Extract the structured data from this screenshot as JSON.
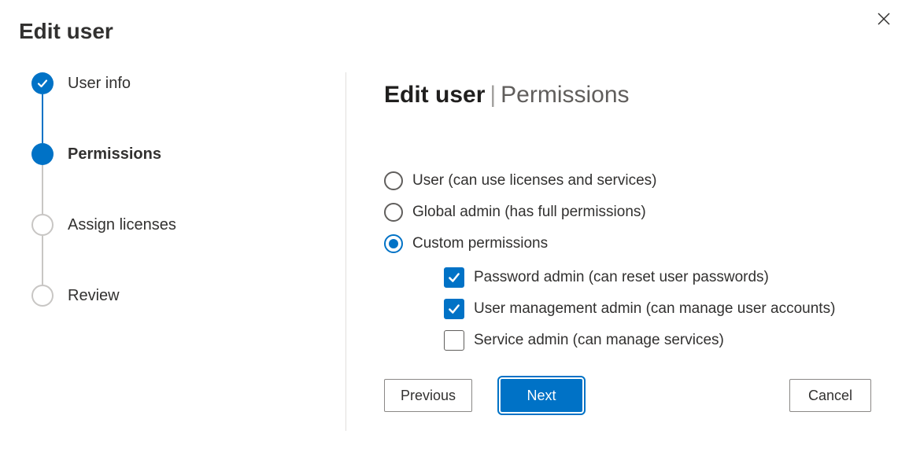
{
  "dialog_title": "Edit user",
  "close_label": "Close",
  "steps": [
    {
      "label": "User info",
      "state": "completed"
    },
    {
      "label": "Permissions",
      "state": "current"
    },
    {
      "label": "Assign licenses",
      "state": "upcoming"
    },
    {
      "label": "Review",
      "state": "upcoming"
    }
  ],
  "panel": {
    "heading_bold": "Edit user",
    "heading_rest": "Permissions"
  },
  "radios": {
    "user": {
      "label": "User (can use licenses and services)",
      "selected": false
    },
    "global": {
      "label": "Global admin (has full permissions)",
      "selected": false
    },
    "custom": {
      "label": "Custom permissions",
      "selected": true
    }
  },
  "custom_checks": {
    "password": {
      "label": "Password admin (can reset user passwords)",
      "checked": true
    },
    "usermgmt": {
      "label": "User management admin (can manage user accounts)",
      "checked": true
    },
    "service": {
      "label": "Service admin (can manage services)",
      "checked": false
    }
  },
  "buttons": {
    "previous": "Previous",
    "next": "Next",
    "cancel": "Cancel"
  }
}
